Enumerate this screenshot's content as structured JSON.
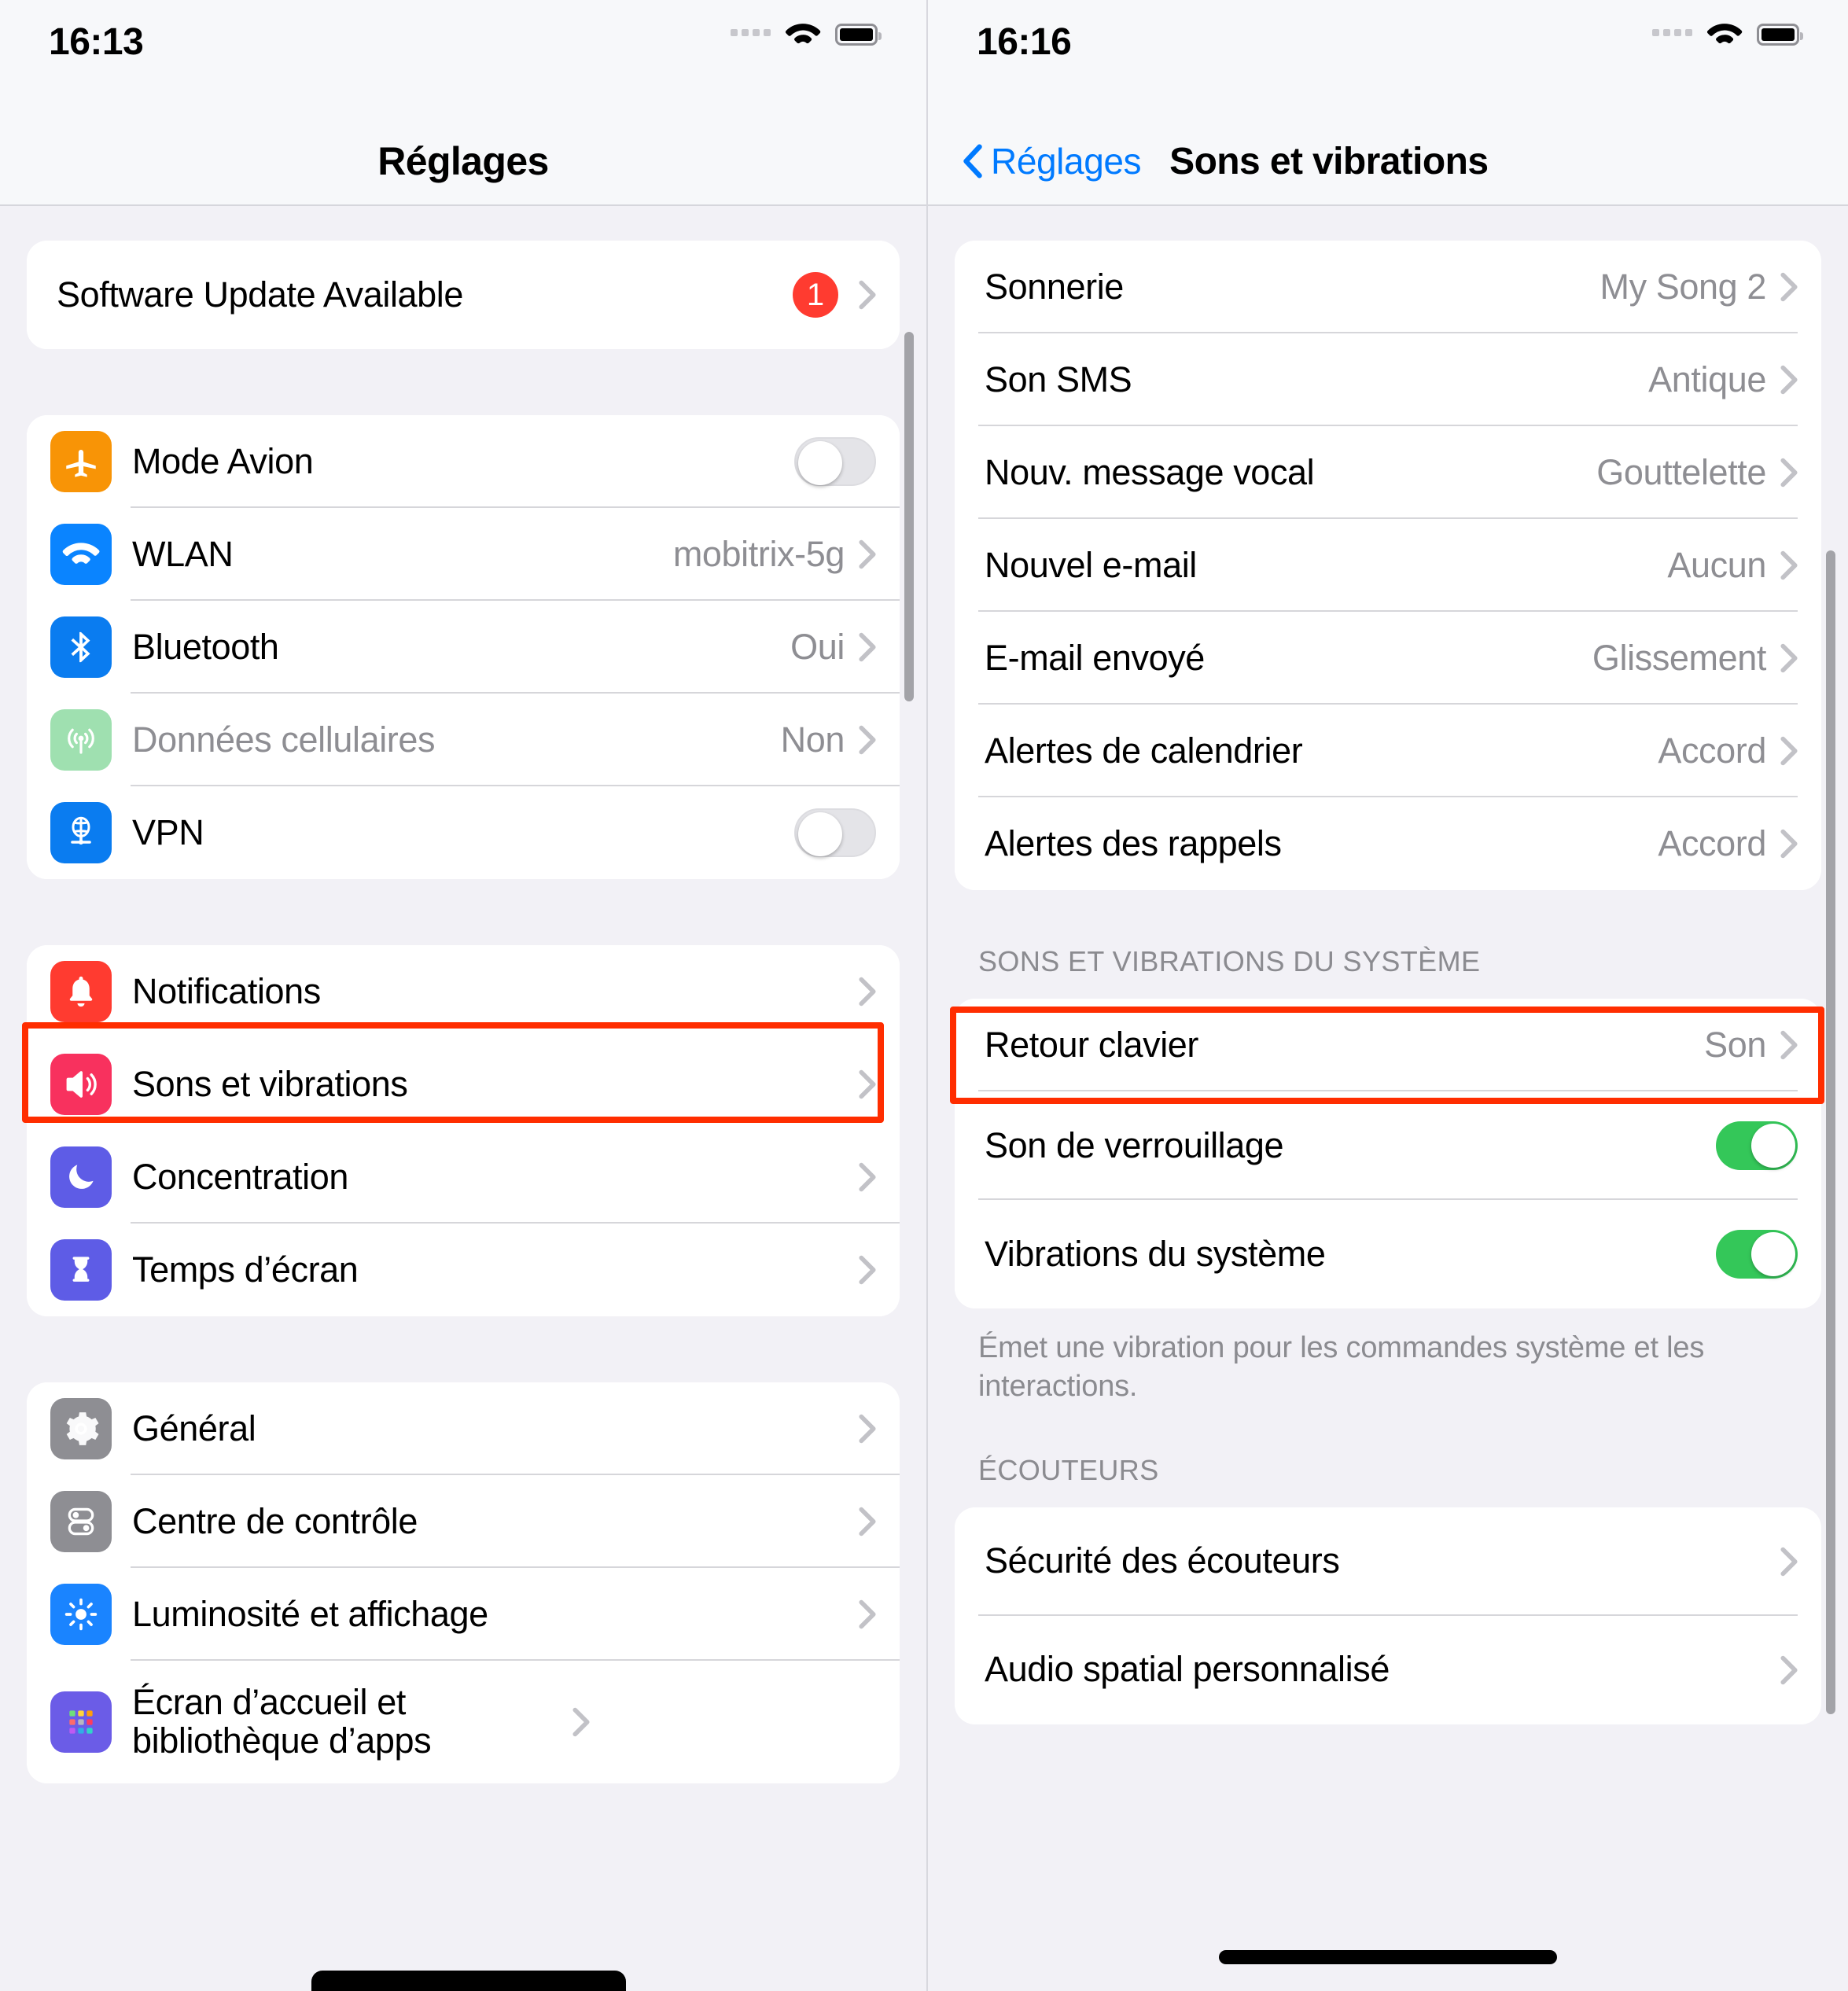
{
  "left": {
    "status": {
      "time": "16:13",
      "wifi_icon": "wifi-icon",
      "battery_icon": "battery-full-icon",
      "signal_icon": "signal-dots-icon"
    },
    "nav": {
      "title": "Réglages"
    },
    "update_row": {
      "label": "Software Update Available",
      "badge": "1"
    },
    "connectivity": [
      {
        "label": "Mode Avion",
        "icon": "airplane-icon",
        "value": "",
        "control": "toggle-off",
        "dim": false
      },
      {
        "label": "WLAN",
        "icon": "wifi-icon",
        "value": "mobitrix-5g",
        "control": "chevron",
        "dim": false
      },
      {
        "label": "Bluetooth",
        "icon": "bluetooth-icon",
        "value": "Oui",
        "control": "chevron",
        "dim": false
      },
      {
        "label": "Données cellulaires",
        "icon": "cellular-icon",
        "value": "Non",
        "control": "chevron",
        "dim": true
      },
      {
        "label": "VPN",
        "icon": "vpn-globe-icon",
        "value": "",
        "control": "toggle-off",
        "dim": false
      }
    ],
    "notifications_group": [
      {
        "label": "Notifications",
        "icon": "bell-icon",
        "highlighted": false
      },
      {
        "label": "Sons et vibrations",
        "icon": "speaker-icon",
        "highlighted": true
      },
      {
        "label": "Concentration",
        "icon": "moon-icon",
        "highlighted": false
      },
      {
        "label": "Temps d’écran",
        "icon": "hourglass-icon",
        "highlighted": false
      }
    ],
    "general_group": [
      {
        "label": "Général",
        "icon": "gear-icon"
      },
      {
        "label": "Centre de contrôle",
        "icon": "control-center-icon"
      },
      {
        "label": "Luminosité et affichage",
        "icon": "brightness-icon"
      },
      {
        "label": "Écran d’accueil et bibliothèque d’apps",
        "icon": "app-grid-icon"
      }
    ]
  },
  "right": {
    "status": {
      "time": "16:16",
      "wifi_icon": "wifi-icon",
      "battery_icon": "battery-full-icon",
      "signal_icon": "signal-dots-icon"
    },
    "nav": {
      "back_label": "Réglages",
      "title": "Sons et vibrations",
      "back_icon": "chevron-left-icon"
    },
    "sounds": [
      {
        "label": "Sonnerie",
        "value": "My Song 2"
      },
      {
        "label": "Son SMS",
        "value": "Antique"
      },
      {
        "label": "Nouv. message vocal",
        "value": "Gouttelette"
      },
      {
        "label": "Nouvel e-mail",
        "value": "Aucun"
      },
      {
        "label": "E-mail envoyé",
        "value": "Glissement"
      },
      {
        "label": "Alertes de calendrier",
        "value": "Accord"
      },
      {
        "label": "Alertes des rappels",
        "value": "Accord"
      }
    ],
    "system_header": "Sons et vibrations du système",
    "system_rows": [
      {
        "label": "Retour clavier",
        "value": "Son",
        "control": "chevron"
      },
      {
        "label": "Son de verrouillage",
        "value": "",
        "control": "toggle-on"
      },
      {
        "label": "Vibrations du système",
        "value": "",
        "control": "toggle-on"
      }
    ],
    "system_footer": "Émet une vibration pour les commandes système et les interactions.",
    "headphones_header": "Écouteurs",
    "headphones_rows": [
      {
        "label": "Sécurité des écouteurs",
        "highlighted": true
      },
      {
        "label": "Audio spatial personnalisé",
        "highlighted": false
      }
    ]
  },
  "colors": {
    "accent_blue": "#007aff",
    "badge_red": "#ff3b30",
    "toggle_green": "#34c759",
    "highlight_red": "#ff2d00",
    "secondary_gray": "#8e8e93"
  }
}
